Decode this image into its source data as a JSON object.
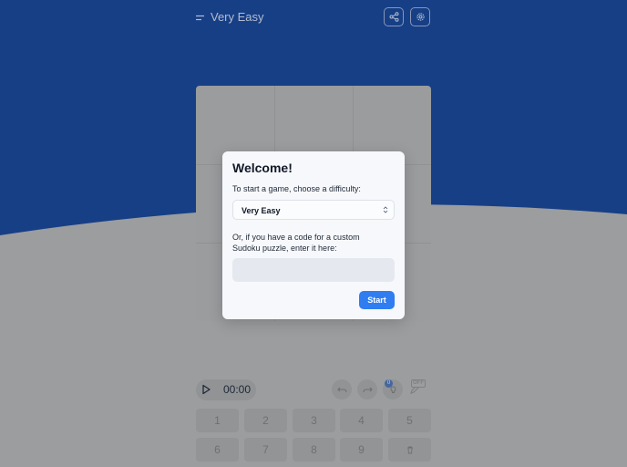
{
  "header": {
    "difficulty_label": "Very Easy"
  },
  "timer": {
    "time": "00:00"
  },
  "hints": {
    "count": "0"
  },
  "notes": {
    "toggle_label": "OFF"
  },
  "numpad": {
    "keys": [
      "1",
      "2",
      "3",
      "4",
      "5",
      "6",
      "7",
      "8",
      "9"
    ]
  },
  "modal": {
    "title": "Welcome!",
    "prompt": "To start a game, choose a difficulty:",
    "difficulty_selected": "Very Easy",
    "code_prompt": "Or, if you have a code for a custom Sudoku puzzle, enter it here:",
    "code_value": "",
    "start_label": "Start"
  },
  "colors": {
    "blue_bg": "#173f86",
    "overlay_gray": "#9b9d9f",
    "modal_bg": "#f7f8fb",
    "accent": "#2f7df0"
  },
  "icons": {
    "menu": "menu-icon",
    "share": "share-icon",
    "settings": "gear-icon",
    "play": "play-icon",
    "undo": "undo-icon",
    "redo": "redo-icon",
    "hint": "lightbulb-icon",
    "notes": "pencil-icon",
    "erase": "trash-icon",
    "select": "chevron-updown-icon"
  }
}
